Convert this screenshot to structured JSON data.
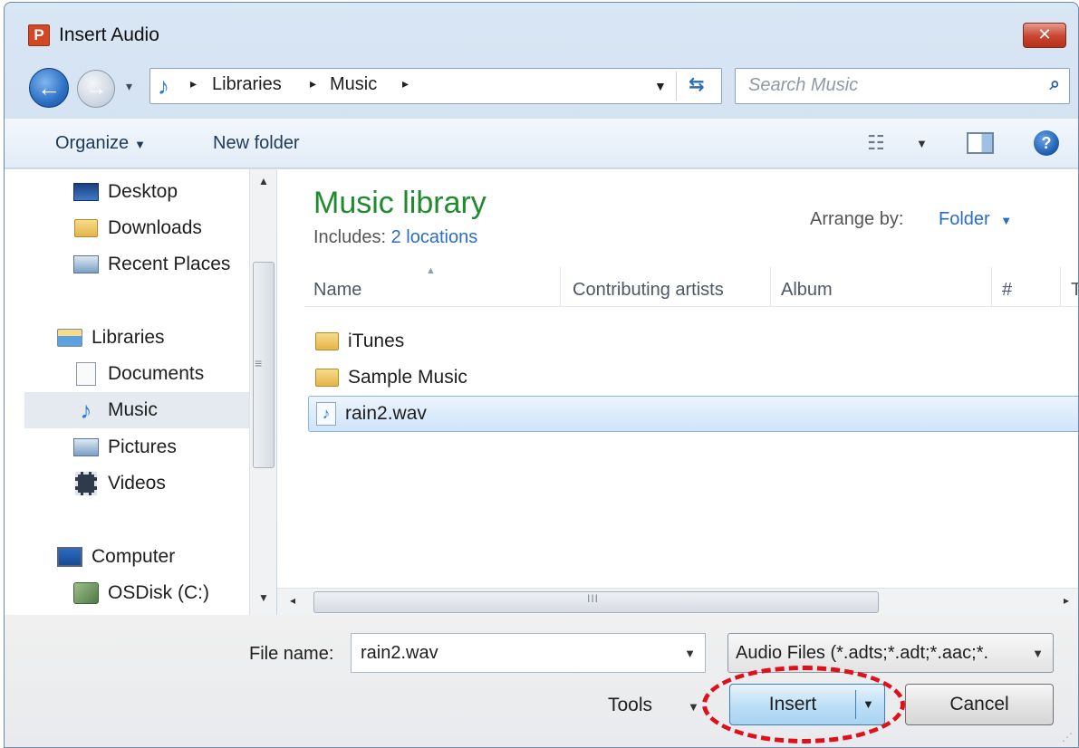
{
  "window": {
    "title": "Insert Audio",
    "app_icon_letter": "P",
    "close_symbol": "✕"
  },
  "address": {
    "crumbs": [
      "Libraries",
      "Music"
    ]
  },
  "search": {
    "placeholder": "Search Music"
  },
  "toolbar": {
    "organize_label": "Organize",
    "new_folder_label": "New folder"
  },
  "nav_pane": {
    "items": [
      {
        "label": "Desktop",
        "icon": "desktop-icon"
      },
      {
        "label": "Downloads",
        "icon": "downloads-folder-icon"
      },
      {
        "label": "Recent Places",
        "icon": "recent-places-icon"
      },
      {
        "label": "Libraries",
        "icon": "libraries-icon"
      },
      {
        "label": "Documents",
        "icon": "documents-icon"
      },
      {
        "label": "Music",
        "icon": "music-icon",
        "selected": true
      },
      {
        "label": "Pictures",
        "icon": "pictures-icon"
      },
      {
        "label": "Videos",
        "icon": "videos-icon"
      },
      {
        "label": "Computer",
        "icon": "computer-icon"
      },
      {
        "label": "OSDisk (C:)",
        "icon": "disk-icon"
      }
    ]
  },
  "content": {
    "library_title": "Music library",
    "includes_label": "Includes:",
    "includes_link": "2 locations",
    "arrange_label": "Arrange by:",
    "arrange_value": "Folder",
    "columns": [
      "Name",
      "Contributing artists",
      "Album",
      "#",
      "T"
    ],
    "files": [
      {
        "name": "iTunes",
        "type": "folder"
      },
      {
        "name": "Sample Music",
        "type": "folder"
      },
      {
        "name": "rain2.wav",
        "type": "audio",
        "selected": true
      }
    ]
  },
  "footer": {
    "file_name_label": "File name:",
    "file_name_value": "rain2.wav",
    "file_type_value": "Audio Files (*.adts;*.adt;*.aac;*.",
    "tools_label": "Tools",
    "insert_label": "Insert",
    "cancel_label": "Cancel"
  },
  "colors": {
    "library_title": "#1e8b2e",
    "link": "#2a6ccc",
    "highlight_ring": "#e0101a"
  }
}
